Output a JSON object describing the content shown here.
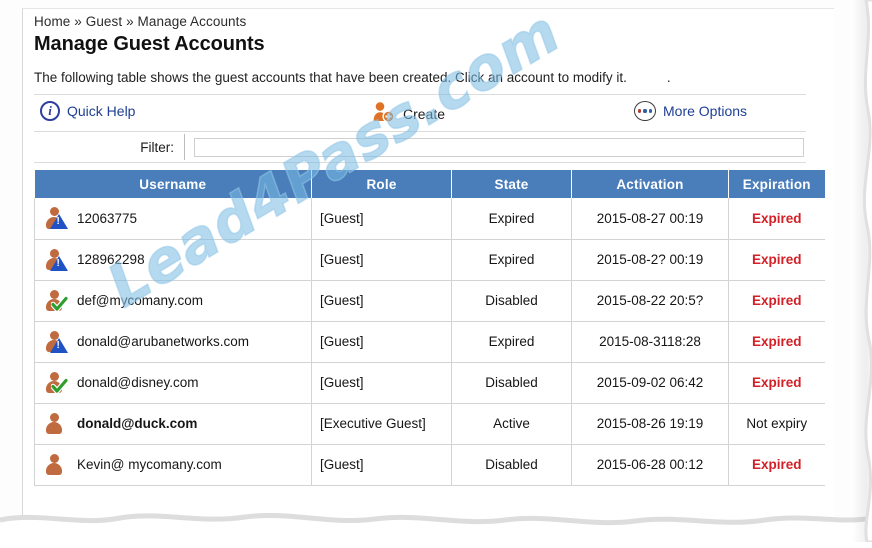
{
  "breadcrumb": "Home » Guest » Manage Accounts",
  "page_title": "Manage Guest Accounts",
  "intro_text": "The following table shows the guest accounts that have been created. Click an account to modify it.",
  "intro_trailing": ".",
  "watermark": "Lead4Pass.com",
  "colors": {
    "table_header_blue": "#4a7ebb",
    "link_blue": "#1f3f94",
    "expired_red": "#d31f26",
    "person_orange": "#bf6b3f",
    "warn_badge_blue": "#1f52c4",
    "check_badge_green": "#2f9e2f",
    "watermark_blue": "#78b9e1"
  },
  "toolbar": {
    "quick_help_label": "Quick Help",
    "quick_help_icon": "info-circle-icon",
    "create_label": "Create",
    "create_icon": "add-user-icon",
    "more_options_label": "More Options",
    "more_options_icon": "ellipsis-circle-icon"
  },
  "filter": {
    "label": "Filter:",
    "value": "",
    "placeholder": ""
  },
  "table": {
    "columns": [
      "Username",
      "Role",
      "State",
      "Activation",
      "Expiration"
    ],
    "rows": [
      {
        "icon": "user-warning-icon",
        "username": "12063775",
        "role": "[Guest]",
        "state": "Expired",
        "activation": "2015-08-27 00:19",
        "expiration": "Expired",
        "expiration_style": "expired",
        "username_bold": false
      },
      {
        "icon": "user-warning-icon",
        "username": "128962298",
        "role": "[Guest]",
        "state": "Expired",
        "activation": "2015-08-2? 00:19",
        "expiration": "Expired",
        "expiration_style": "expired",
        "username_bold": false
      },
      {
        "icon": "user-check-icon",
        "username": "def@mycomany.com",
        "role": "[Guest]",
        "state": "Disabled",
        "activation": "2015-08-22 20:5?",
        "expiration": "Expired",
        "expiration_style": "expired",
        "username_bold": false
      },
      {
        "icon": "user-warning-icon",
        "username": "donald@arubanetworks.com",
        "role": "[Guest]",
        "state": "Expired",
        "activation": "2015-08-3118:28",
        "expiration": "Expired",
        "expiration_style": "expired",
        "username_bold": false
      },
      {
        "icon": "user-check-icon",
        "username": "donald@disney.com",
        "role": "[Guest]",
        "state": "Disabled",
        "activation": "2015-09-02 06:42",
        "expiration": "Expired",
        "expiration_style": "expired",
        "username_bold": false
      },
      {
        "icon": "user-icon",
        "username": "donald@duck.com",
        "role": "[Executive Guest]",
        "state": "Active",
        "activation": "2015-08-26 19:19",
        "expiration": "Not expiry",
        "expiration_style": "normal",
        "username_bold": true
      },
      {
        "icon": "user-icon",
        "username": "Kevin@ mycomany.com",
        "role": "[Guest]",
        "state": "Disabled",
        "activation": "2015-06-28 00:12",
        "expiration": "Expired",
        "expiration_style": "expired",
        "username_bold": false
      }
    ]
  }
}
